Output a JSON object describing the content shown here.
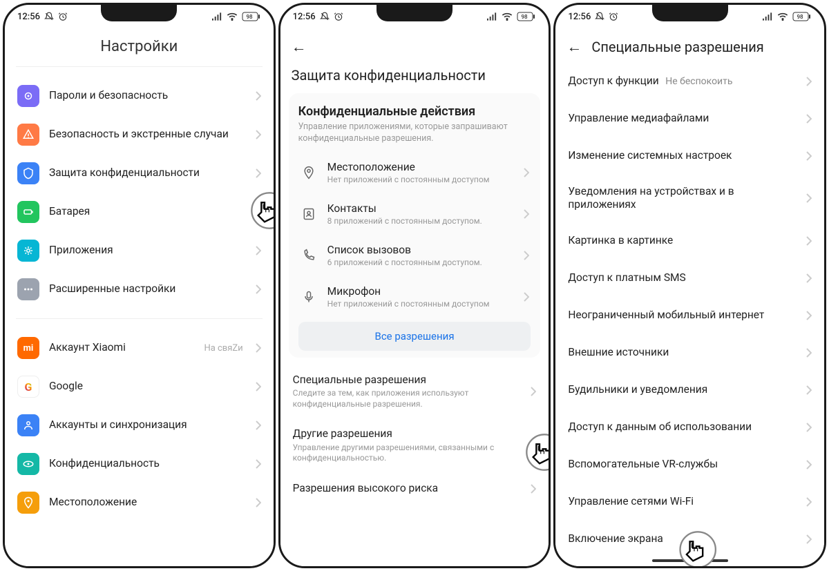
{
  "status": {
    "time": "12:56",
    "battery": "98"
  },
  "screen1": {
    "title": "Настройки",
    "group1": [
      {
        "icon": "shield-icon",
        "bg": "bg-purple",
        "title": "Пароли и безопасность"
      },
      {
        "icon": "warning-icon",
        "bg": "bg-orange",
        "title": "Безопасность и экстренные случаи"
      },
      {
        "icon": "privacy-icon",
        "bg": "bg-blue",
        "title": "Защита конфиденциальности"
      },
      {
        "icon": "battery-icon",
        "bg": "bg-green",
        "title": "Батарея"
      },
      {
        "icon": "apps-icon",
        "bg": "bg-cyan",
        "title": "Приложения"
      },
      {
        "icon": "more-icon",
        "bg": "bg-gray",
        "title": "Расширенные настройки"
      }
    ],
    "group2": [
      {
        "icon": "mi-icon",
        "bg": "bg-mi",
        "title": "Аккаунт Xiaomi",
        "trail": "На свяZи"
      },
      {
        "icon": "google-icon",
        "bg": "bg-white",
        "title": "Google"
      },
      {
        "icon": "sync-icon",
        "bg": "bg-blue",
        "title": "Аккаунты и синхронизация"
      },
      {
        "icon": "eye-icon",
        "bg": "bg-teal",
        "title": "Конфиденциальность"
      },
      {
        "icon": "location-icon",
        "bg": "bg-amber",
        "title": "Местоположение"
      }
    ]
  },
  "screen2": {
    "title": "Защита конфиденциальности",
    "card": {
      "title": "Конфиденциальные действия",
      "desc": "Управление приложениями, которые запрашивают конфиденциальные разрешения.",
      "rows": [
        {
          "icon": "pin-icon",
          "title": "Местоположение",
          "sub": "Нет приложений с постоянным доступом"
        },
        {
          "icon": "contacts-icon",
          "title": "Контакты",
          "sub": "8 приложений с постоянным доступом."
        },
        {
          "icon": "phone-icon",
          "title": "Список вызовов",
          "sub": "6 приложений с постоянным доступом."
        },
        {
          "icon": "mic-icon",
          "title": "Микрофон",
          "sub": "Нет приложений с постоянным доступом"
        }
      ],
      "all": "Все разрешения"
    },
    "below": [
      {
        "title": "Специальные разрешения",
        "sub": "Следите за тем, как приложения используют конфиденциальные разрешения."
      },
      {
        "title": "Другие разрешения",
        "sub": "Управление другими разрешениями, связанными с конфиденциальностью."
      },
      {
        "title": "Разрешения высокого риска"
      }
    ]
  },
  "screen3": {
    "title": "Специальные разрешения",
    "rows": [
      {
        "title": "Доступ к функции",
        "trail": "Не беспокоить"
      },
      {
        "title": "Управление медиафайлами"
      },
      {
        "title": "Изменение системных настроек"
      },
      {
        "title": "Уведомления на устройствах и в приложениях"
      },
      {
        "title": "Картинка в картинке"
      },
      {
        "title": "Доступ к платным SMS"
      },
      {
        "title": "Неограниченный мобильный интернет"
      },
      {
        "title": "Внешние источники"
      },
      {
        "title": "Будильники и уведомления"
      },
      {
        "title": "Доступ к данным об использовании"
      },
      {
        "title": "Вспомогательные VR-службы"
      },
      {
        "title": "Управление сетями Wi-Fi"
      },
      {
        "title": "Включение экрана"
      }
    ]
  }
}
